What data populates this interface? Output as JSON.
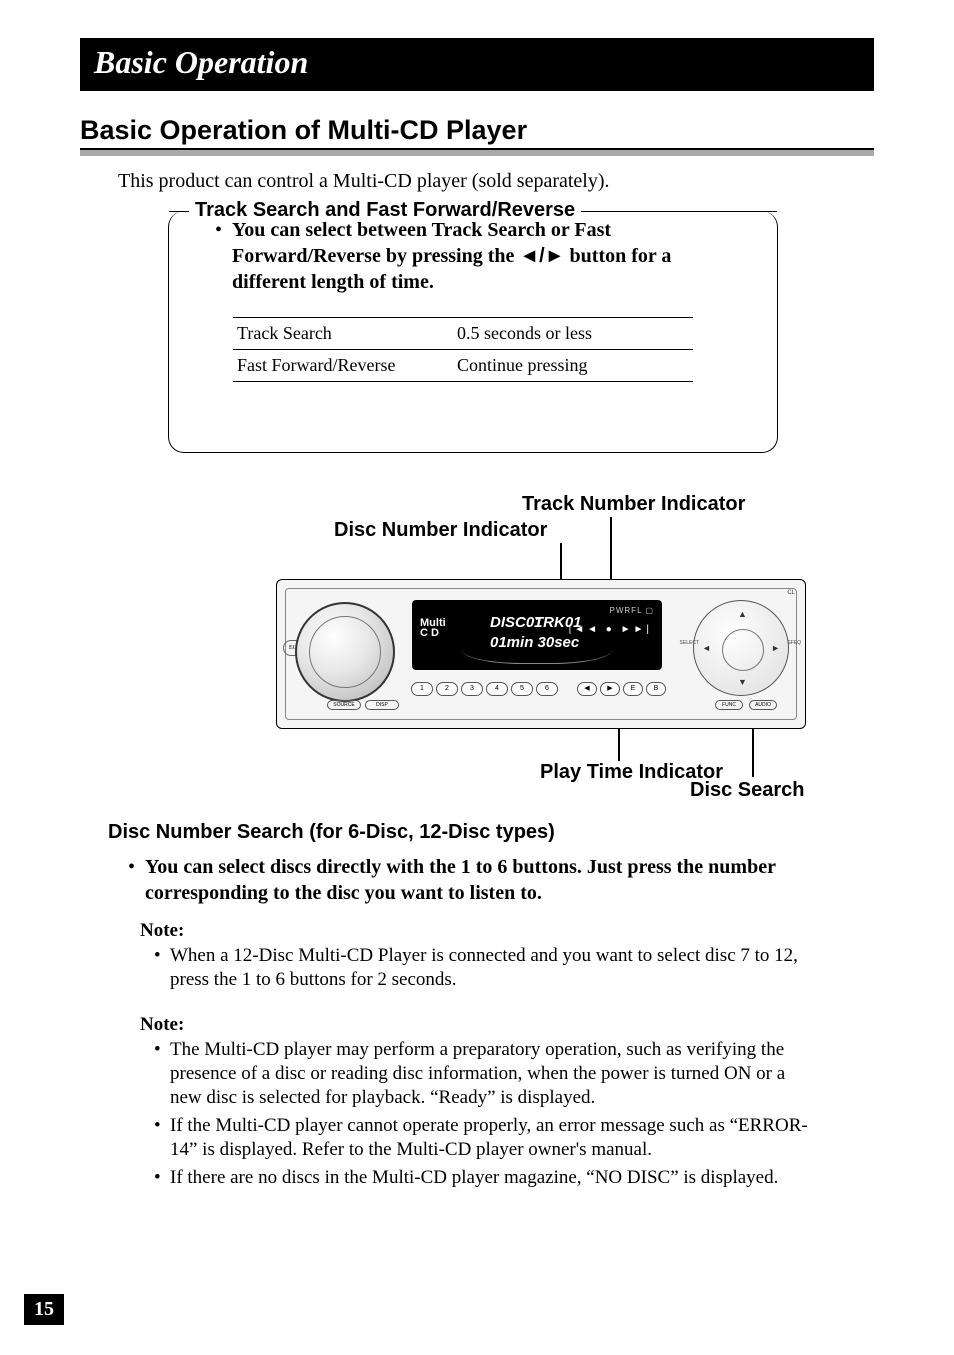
{
  "chapter": "Basic Operation",
  "section": "Basic Operation of Multi-CD Player",
  "intro": "This product can control a Multi-CD player (sold separately).",
  "callout": {
    "title": "Track Search and Fast Forward/Reverse",
    "bullet_prefix": "•",
    "bullet_text_1": "You can select between Track Search or Fast Forward/Reverse by pressing the ",
    "bullet_arrows": "◄/►",
    "bullet_text_2": " button for a different length of time.",
    "rows": [
      {
        "label": "Track Search",
        "value": "0.5 seconds or less"
      },
      {
        "label": "Fast Forward/Reverse",
        "value": "Continue pressing"
      }
    ]
  },
  "diagram": {
    "labels": {
      "track_indicator": "Track Number Indicator",
      "disc_indicator": "Disc Number Indicator",
      "play_time": "Play Time Indicator",
      "disc_search": "Disc Search"
    },
    "screen": {
      "multi_line1": "Multi",
      "multi_line2": "C D",
      "disc": "DISC01",
      "trk": "TRK01",
      "time": "01min 30sec",
      "icons_top": "PWRFL  ▢",
      "transport": "|◄◄  ●  ►►|"
    },
    "preset_buttons": [
      "1",
      "2",
      "3",
      "4",
      "5",
      "6"
    ],
    "arrow_buttons": [
      "◀",
      "▶",
      "E",
      "B"
    ],
    "src_buttons": [
      "SOURCE",
      "DISP"
    ],
    "right_buttons": [
      "FUNC",
      "AUDIO"
    ],
    "eq": "EQ",
    "rc": {
      "select": "SELECT",
      "sfeq": "SFEQ",
      "cl": "CL"
    }
  },
  "disc_number_search": {
    "heading": "Disc Number Search (for 6-Disc, 12-Disc types)",
    "bullet": "You can select discs directly with the 1 to 6 buttons. Just press the number corresponding to the disc you want to listen to.",
    "note1_head": "Note:",
    "note1_items": [
      "When a 12-Disc Multi-CD Player is connected and you want to select disc 7 to 12, press the 1 to 6 buttons for 2 seconds."
    ],
    "note2_head": "Note:",
    "note2_items": [
      "The Multi-CD player may perform a preparatory operation, such as verifying the presence of a disc or reading disc information, when the power is turned ON or a new disc is selected for playback. “Ready” is displayed.",
      "If the Multi-CD player cannot operate properly, an error message such as “ERROR-14” is displayed. Refer to the Multi-CD player owner's manual.",
      "If there are no discs in the Multi-CD player magazine, “NO DISC” is displayed."
    ]
  },
  "page_number": "15"
}
